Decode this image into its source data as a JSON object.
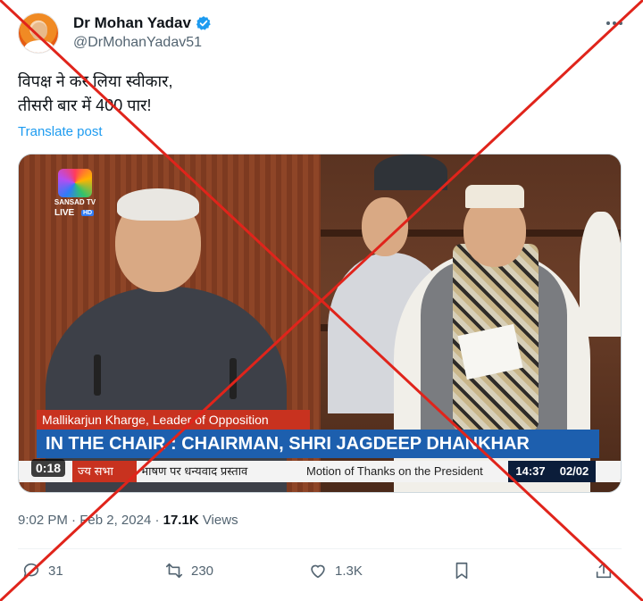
{
  "post": {
    "author": {
      "display_name": "Dr Mohan Yadav",
      "handle": "@DrMohanYadav51",
      "verified": true
    },
    "more_icon": "more-horizontal-icon",
    "text_lines": [
      "विपक्ष ने कर लिया स्वीकार,",
      "तीसरी बार में 400 पार!"
    ],
    "translate_label": "Translate post",
    "media": {
      "logo_name": "SANSAD TV",
      "logo_live": "LIVE",
      "logo_hd": "HD",
      "lower_third_name": "Mallikarjun Kharge, Leader of Opposition",
      "lower_third_chair": "IN THE CHAIR : CHAIRMAN, SHRI JAGDEEP DHANKHAR",
      "ticker_left": "ज्य सभा",
      "ticker_hindi": "भाषण पर धन्यवाद प्रस्ताव",
      "ticker_english": "Motion of Thanks on the President",
      "ticker_time": "14:37",
      "ticker_date": "02/02",
      "duration": "0:18"
    },
    "meta": {
      "time": "9:02 PM",
      "separator": "·",
      "date": "Feb 2, 2024",
      "views_count": "17.1K",
      "views_label": "Views"
    },
    "actions": {
      "reply_count": "31",
      "repost_count": "230",
      "like_count": "1.3K"
    }
  },
  "colors": {
    "accent": "#1d9bf0",
    "cross": "#e0241b",
    "text_secondary": "#536471"
  }
}
